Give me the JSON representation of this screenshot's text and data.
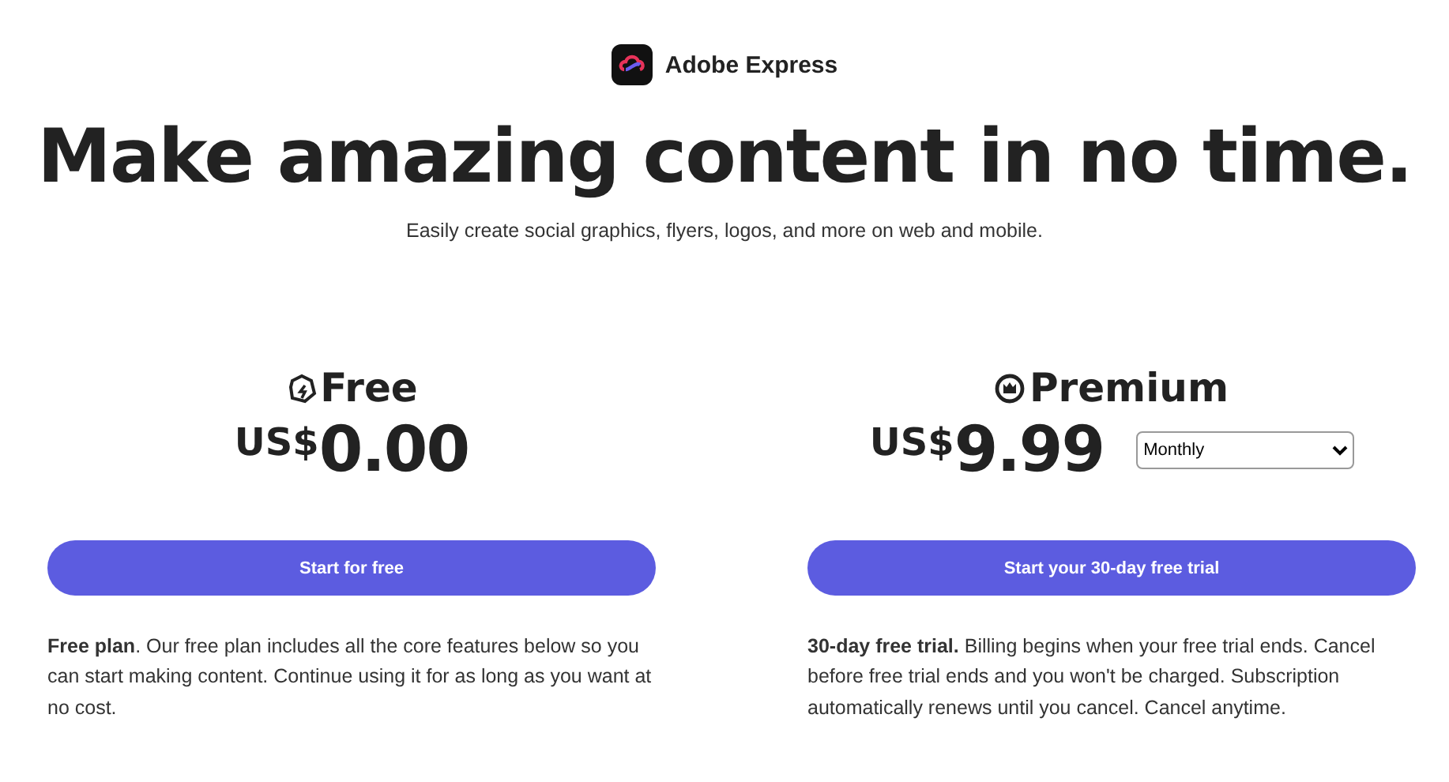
{
  "brand": {
    "name": "Adobe Express"
  },
  "headline": "Make amazing content in no time.",
  "subtitle": "Easily create social graphics, flyers, logos, and more on web and mobile.",
  "plans": [
    {
      "kind": "free",
      "name": "Free",
      "currency": "US$",
      "amount": "0.00",
      "button": "Start for free",
      "description": "**Free plan**. Our free plan includes all the core features below so you can start making content. Continue using it for as long as you want at no cost."
    },
    {
      "kind": "premium",
      "name": "Premium",
      "currency": "US$",
      "amount": "9.99",
      "billing": {
        "value": "Monthly"
      },
      "button": "Start your 30-day free trial",
      "description": "**30-day free trial.** Billing begins when your free trial ends. Cancel before free trial ends and you won't be charged. Subscription automatically renews until you cancel. Cancel anytime."
    }
  ]
}
